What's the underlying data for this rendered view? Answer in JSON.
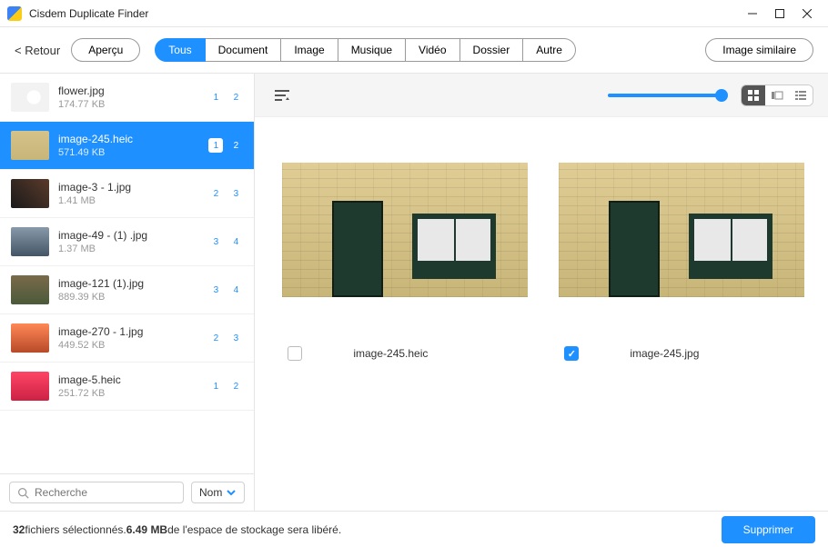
{
  "titlebar": {
    "title": "Cisdem Duplicate Finder"
  },
  "toolbar": {
    "back": "< Retour",
    "preview": "Aperçu",
    "tabs": [
      "Tous",
      "Document",
      "Image",
      "Musique",
      "Vidéo",
      "Dossier",
      "Autre"
    ],
    "active_tab": 0,
    "similar": "Image similaire"
  },
  "files": [
    {
      "name": "flower.jpg",
      "size": "174.77 KB",
      "b1": "1",
      "b2": "2",
      "selected": false
    },
    {
      "name": "image-245.heic",
      "size": "571.49 KB",
      "b1": "1",
      "b2": "2",
      "selected": true
    },
    {
      "name": "image-3 - 1.jpg",
      "size": "1.41 MB",
      "b1": "2",
      "b2": "3",
      "selected": false
    },
    {
      "name": "image-49 - (1) .jpg",
      "size": "1.37 MB",
      "b1": "3",
      "b2": "4",
      "selected": false
    },
    {
      "name": "image-121 (1).jpg",
      "size": "889.39 KB",
      "b1": "3",
      "b2": "4",
      "selected": false
    },
    {
      "name": "image-270 - 1.jpg",
      "size": "449.52 KB",
      "b1": "2",
      "b2": "3",
      "selected": false
    },
    {
      "name": "image-5.heic",
      "size": "251.72 KB",
      "b1": "1",
      "b2": "2",
      "selected": false
    }
  ],
  "thumb_bg": [
    "radial-gradient(circle at 60% 50%, #fff 25%, #f2f2f2 26%)",
    "linear-gradient(#d4c28a,#c8b578)",
    "linear-gradient(45deg,#1a1a1a,#5a3a2a)",
    "linear-gradient(#8899aa,#445566)",
    "linear-gradient(#7a6a4a,#4a5a3a)",
    "linear-gradient(#ff8855,#b84a2a)",
    "linear-gradient(#ff4466,#cc2244)"
  ],
  "search": {
    "placeholder": "Recherche"
  },
  "sort": {
    "label": "Nom"
  },
  "preview": {
    "items": [
      {
        "name": "image-245.heic",
        "checked": false
      },
      {
        "name": "image-245.jpg",
        "checked": true
      }
    ]
  },
  "status": {
    "count": "32",
    "text1": " fichiers sélectionnés. ",
    "size": "6.49 MB",
    "text2": "  de l'espace de stockage sera libéré.",
    "delete": "Supprimer"
  }
}
